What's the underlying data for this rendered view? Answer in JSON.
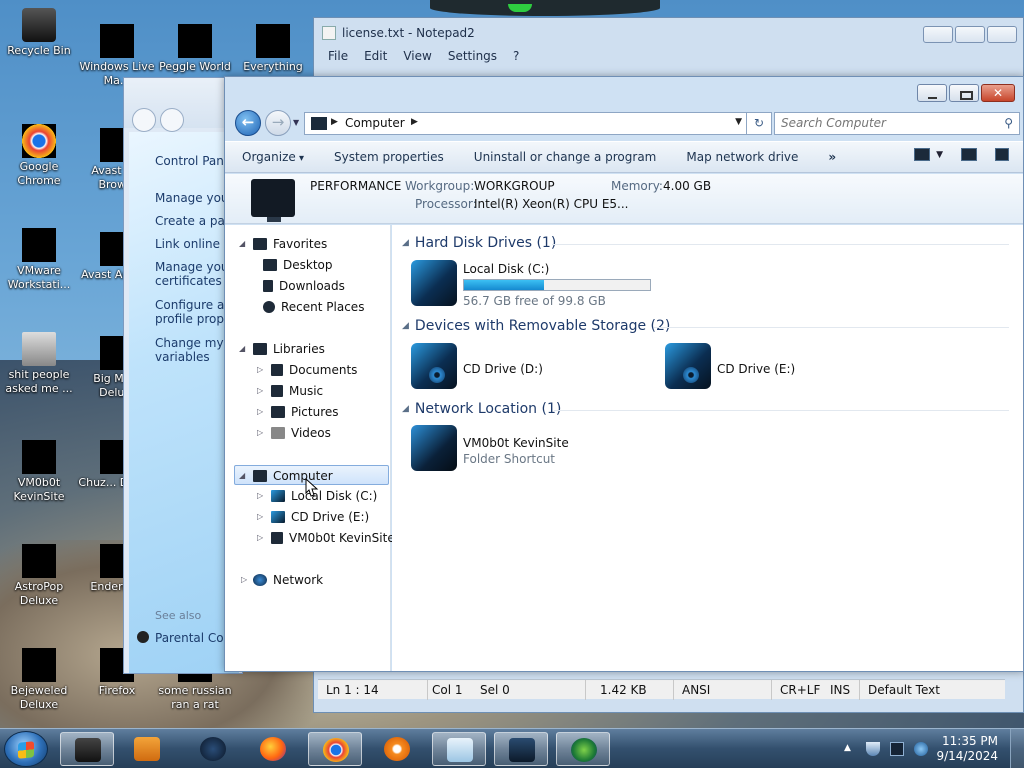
{
  "desktop": {
    "icons": [
      {
        "label": "Recycle Bin"
      },
      {
        "label": "Windows Live Ma..."
      },
      {
        "label": "Peggle World"
      },
      {
        "label": "Everything"
      },
      {
        "label": "Google Chrome"
      },
      {
        "label": "Avast S... Brow..."
      },
      {
        "label": "VMware Workstati..."
      },
      {
        "label": "Avast Antiv..."
      },
      {
        "label": "shit people asked me ..."
      },
      {
        "label": "Big Mo... Delu..."
      },
      {
        "label": "VM0b0t KevinSite"
      },
      {
        "label": "Chuz... Delu..."
      },
      {
        "label": "AstroPop Deluxe"
      },
      {
        "label": "Enderm..."
      },
      {
        "label": "Bejeweled Deluxe"
      },
      {
        "label": "Firefox"
      },
      {
        "label": "some russian ran a rat"
      }
    ]
  },
  "notepad": {
    "title": "license.txt - Notepad2",
    "menu": [
      "File",
      "Edit",
      "View",
      "Settings",
      "?"
    ],
    "status": {
      "position": "Ln 1 : 14",
      "col": "Col 1",
      "sel": "Sel 0",
      "size": "1.42 KB",
      "encoding": "ANSI",
      "eol": "CR+LF",
      "ins": "INS",
      "scheme": "Default Text"
    }
  },
  "control_panel": {
    "home": "Control Pane",
    "links": [
      "Manage you",
      "Create a pas",
      "Link online I",
      "Manage you certificates",
      "Configure ac profile prope",
      "Change my variables"
    ],
    "see_also": "See also",
    "parental": "Parental Con"
  },
  "explorer": {
    "address": {
      "segment": "Computer"
    },
    "search_placeholder": "Search Computer",
    "toolbar": {
      "organize": "Organize",
      "system_properties": "System properties",
      "uninstall": "Uninstall or change a program",
      "map_drive": "Map network drive",
      "more": "»"
    },
    "details": {
      "name": "PERFORMANCE",
      "workgroup_label": "Workgroup:",
      "workgroup": "WORKGROUP",
      "memory_label": "Memory:",
      "memory": "4.00 GB",
      "processor_label": "Processor:",
      "processor": "Intel(R) Xeon(R) CPU E5..."
    },
    "nav": {
      "favorites": "Favorites",
      "desktop": "Desktop",
      "downloads": "Downloads",
      "recent": "Recent Places",
      "libraries": "Libraries",
      "documents": "Documents",
      "music": "Music",
      "pictures": "Pictures",
      "videos": "Videos",
      "computer": "Computer",
      "local_disk": "Local Disk (C:)",
      "cd_drive_e": "CD Drive (E:)",
      "kevinsite": "VM0b0t KevinSite",
      "network": "Network"
    },
    "groups": {
      "hdd": "Hard Disk Drives (1)",
      "removable": "Devices with Removable Storage (2)",
      "network": "Network Location (1)"
    },
    "drives": {
      "c_name": "Local Disk (C:)",
      "c_free": "56.7 GB free of 99.8 GB",
      "c_used_fraction": 0.43,
      "d_name": "CD Drive (D:)",
      "e_name": "CD Drive (E:)",
      "net_name": "VM0b0t KevinSite",
      "net_sub": "Folder Shortcut"
    }
  },
  "taskbar": {
    "time": "11:35 PM",
    "date": "9/14/2024"
  },
  "colors": {
    "accent": "#1f63b4",
    "drive_fill": "#158ad0",
    "group_text": "#1e3a6a"
  }
}
